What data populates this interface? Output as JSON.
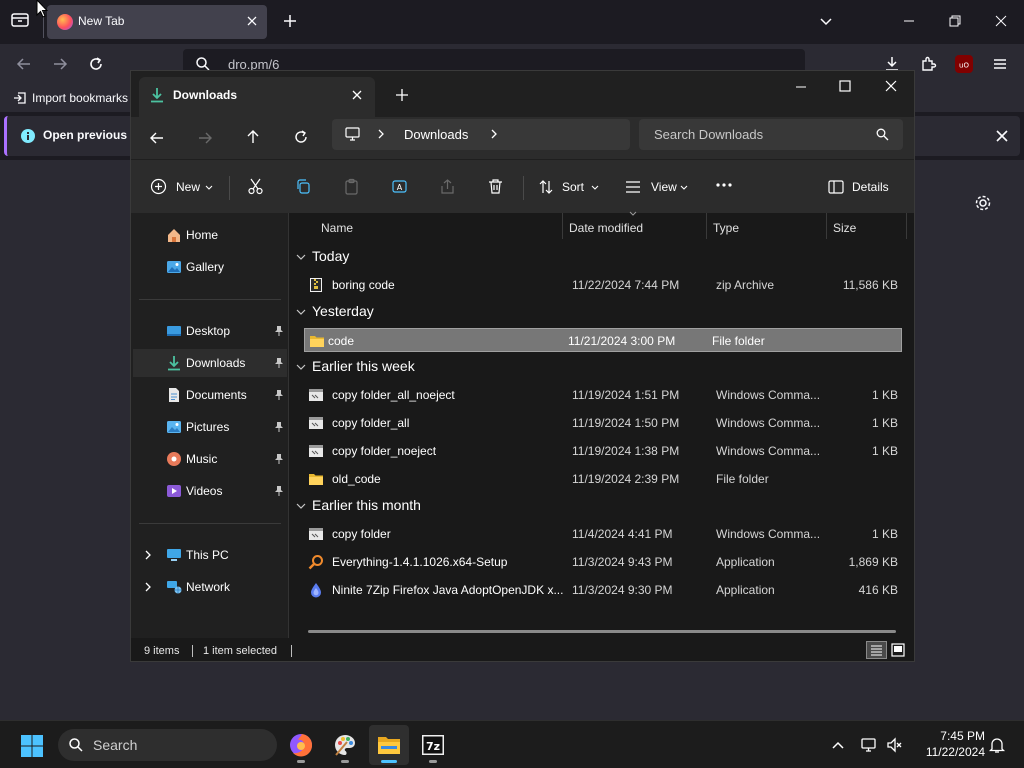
{
  "browser": {
    "tab_title": "New Tab",
    "url_text": "dro.pm/6",
    "bookmark_import": "Import bookmarks",
    "info_bar_text": "Open previous ta",
    "colors": {
      "accent": "#ab71ff",
      "frame": "#1c1b22",
      "toolbar": "#2b2a33"
    }
  },
  "explorer": {
    "tab_title": "Downloads",
    "breadcrumb": "Downloads",
    "search_placeholder": "Search Downloads",
    "toolbar": {
      "new": "New",
      "sort": "Sort",
      "view": "View",
      "details": "Details"
    },
    "nav": {
      "home": "Home",
      "gallery": "Gallery",
      "desktop": "Desktop",
      "downloads": "Downloads",
      "documents": "Documents",
      "pictures": "Pictures",
      "music": "Music",
      "videos": "Videos",
      "this_pc": "This PC",
      "network": "Network"
    },
    "columns": {
      "name": "Name",
      "date": "Date modified",
      "type": "Type",
      "size": "Size"
    },
    "groups": {
      "today": "Today",
      "yesterday": "Yesterday",
      "week": "Earlier this week",
      "month": "Earlier this month"
    },
    "files": [
      {
        "name": "boring code",
        "date": "11/22/2024 7:44 PM",
        "type": "zip Archive",
        "size": "11,586 KB",
        "icon": "zip-icon"
      },
      {
        "name": "code",
        "date": "11/21/2024 3:00 PM",
        "type": "File folder",
        "size": "",
        "icon": "folder-icon"
      },
      {
        "name": "copy folder_all_noeject",
        "date": "11/19/2024 1:51 PM",
        "type": "Windows Comma...",
        "size": "1 KB",
        "icon": "batch-file-icon"
      },
      {
        "name": "copy folder_all",
        "date": "11/19/2024 1:50 PM",
        "type": "Windows Comma...",
        "size": "1 KB",
        "icon": "batch-file-icon"
      },
      {
        "name": "copy folder_noeject",
        "date": "11/19/2024 1:38 PM",
        "type": "Windows Comma...",
        "size": "1 KB",
        "icon": "batch-file-icon"
      },
      {
        "name": "old_code",
        "date": "11/19/2024 2:39 PM",
        "type": "File folder",
        "size": "",
        "icon": "folder-icon"
      },
      {
        "name": "copy folder",
        "date": "11/4/2024 4:41 PM",
        "type": "Windows Comma...",
        "size": "1 KB",
        "icon": "batch-file-icon"
      },
      {
        "name": "Everything-1.4.1.1026.x64-Setup",
        "date": "11/3/2024 9:43 PM",
        "type": "Application",
        "size": "1,869 KB",
        "icon": "everything-app-icon"
      },
      {
        "name": "Ninite 7Zip Firefox Java AdoptOpenJDK x...",
        "date": "11/3/2024 9:30 PM",
        "type": "Application",
        "size": "416 KB",
        "icon": "ninite-app-icon"
      }
    ],
    "status": {
      "items": "9 items",
      "selected": "1 item selected"
    }
  },
  "taskbar": {
    "search_label": "Search",
    "time": "7:45 PM",
    "date": "11/22/2024"
  }
}
